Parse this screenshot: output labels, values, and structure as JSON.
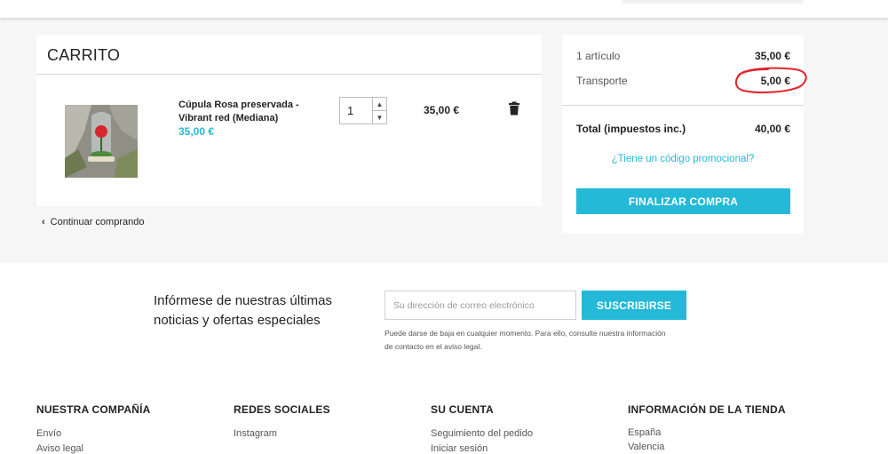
{
  "cart": {
    "title": "CARRITO",
    "item": {
      "name": "Cúpula Rosa preservada - Vibrant red (Mediana)",
      "unit_price": "35,00 €",
      "quantity": "1",
      "line_total": "35,00 €"
    },
    "continue_label": "Continuar comprando"
  },
  "summary": {
    "items_label": "1 artículo",
    "items_value": "35,00 €",
    "shipping_label": "Transporte",
    "shipping_value": "5,00 €",
    "total_label": "Total (impuestos inc.)",
    "total_value": "40,00 €",
    "promo_label": "¿Tiene un código promocional?",
    "checkout_label": "FINALIZAR COMPRA"
  },
  "newsletter": {
    "text": "Infórmese de nuestras últimas noticias y ofertas especiales",
    "placeholder": "Su dirección de correo electrónico",
    "button_label": "SUSCRIBIRSE",
    "note": "Puede darse de baja en cualquier momento. Para ello, consulte nuestra información de contacto en el aviso legal."
  },
  "footer": {
    "company": {
      "title": "NUESTRA COMPAÑÍA",
      "links": [
        "Envío",
        "Aviso legal"
      ]
    },
    "social": {
      "title": "REDES SOCIALES",
      "links": [
        "Instagram"
      ]
    },
    "account": {
      "title": "SU CUENTA",
      "links": [
        "Seguimiento del pedido",
        "Iniciar sesión"
      ]
    },
    "store": {
      "title": "INFORMACIÓN DE LA TIENDA",
      "lines": [
        "España",
        "Valencia"
      ]
    }
  },
  "colors": {
    "accent": "#24b9d7",
    "annotation": "#e0242a",
    "page_bg": "#f6f6f6"
  },
  "icons": {
    "trash": "trash-icon",
    "back": "chevron-left-icon",
    "qty_up": "chevron-up-icon",
    "qty_down": "chevron-down-icon"
  }
}
